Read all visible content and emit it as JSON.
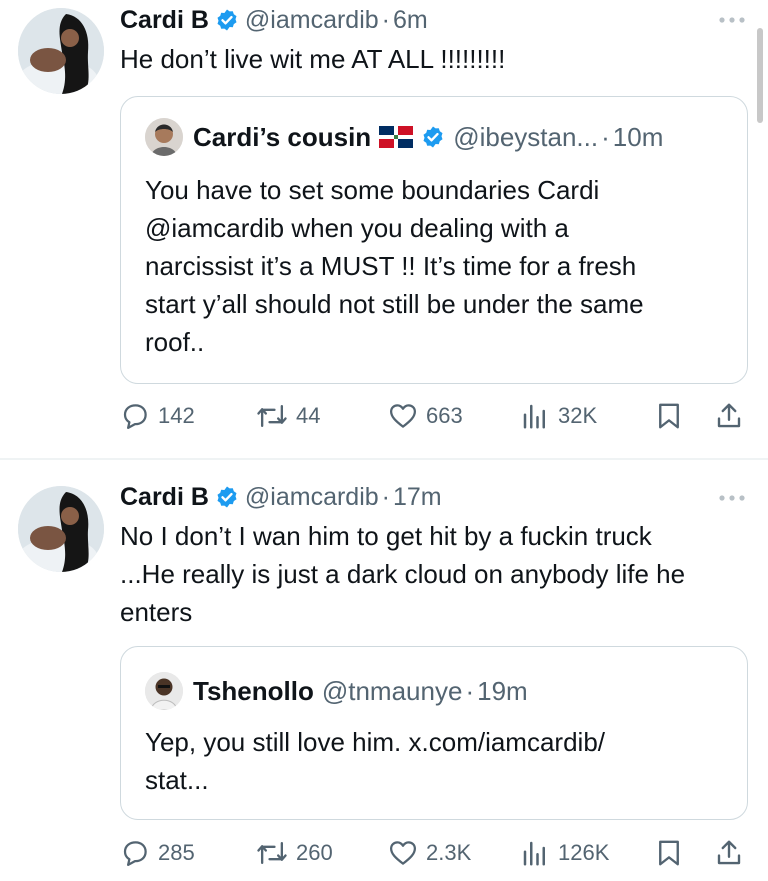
{
  "tweets": [
    {
      "author": {
        "name": "Cardi B",
        "handle": "@iamcardib",
        "verified": true
      },
      "time": "6m",
      "text": "He don’t live wit me AT ALL !!!!!!!!!",
      "quote": {
        "author": {
          "name": "Cardi’s cousin",
          "handle": "@ibeystan...",
          "verified": true,
          "flag": "dominican-republic-flag"
        },
        "time": "10m",
        "text_lines": [
          "You have to set some boundaries Cardi",
          "@iamcardib when you dealing with a",
          "narcissist it’s a MUST !!  It’s time for a fresh",
          "start y’all should not still be under the same",
          "roof.."
        ]
      },
      "stats": {
        "replies": "142",
        "retweets": "44",
        "likes": "663",
        "views": "32K"
      }
    },
    {
      "author": {
        "name": "Cardi B",
        "handle": "@iamcardib",
        "verified": true
      },
      "time": "17m",
      "text_lines": [
        "No I don’t I wan him to get hit by a fuckin truck",
        "...He really is just a dark cloud on anybody life he",
        "enters"
      ],
      "quote": {
        "author": {
          "name": "Tshenollo",
          "handle": "@tnmaunye",
          "verified": false
        },
        "time": "19m",
        "text_lines": [
          "Yep, you still love him. x.com/iamcardib/",
          "stat..."
        ]
      },
      "stats": {
        "replies": "285",
        "retweets": "260",
        "likes": "2.3K",
        "views": "126K"
      }
    }
  ],
  "separator": "·",
  "colors": {
    "verified": "#1d9bf0",
    "muted": "#536471",
    "border": "#cfd9de"
  },
  "icons": [
    "verified-badge-icon",
    "more-icon",
    "reply-icon",
    "retweet-icon",
    "like-icon",
    "views-icon",
    "bookmark-icon",
    "share-icon"
  ]
}
